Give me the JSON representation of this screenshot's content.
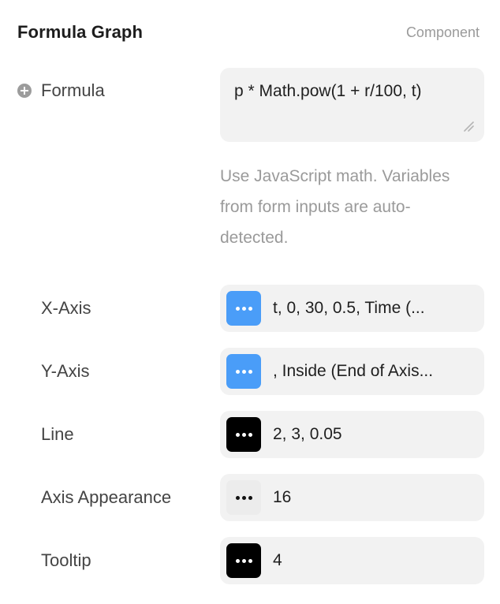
{
  "header": {
    "title": "Formula Graph",
    "badge": "Component"
  },
  "formula": {
    "label": "Formula",
    "value": "p * Math.pow(1 + r/100, t)",
    "hint": "Use JavaScript math. Variables from form inputs are auto-detected."
  },
  "properties": [
    {
      "label": "X-Axis",
      "value": "t, 0, 30, 0.5, Time (...",
      "swatch": "blue",
      "swatch_color": "#4a9df8"
    },
    {
      "label": "Y-Axis",
      "value": ", Inside (End of Axis...",
      "swatch": "blue",
      "swatch_color": "#4a9df8"
    },
    {
      "label": "Line",
      "value": "2, 3, 0.05",
      "swatch": "black",
      "swatch_color": "#000000"
    },
    {
      "label": "Axis Appearance",
      "value": "16",
      "swatch": "light",
      "swatch_color": "#ececec"
    },
    {
      "label": "Tooltip",
      "value": "4",
      "swatch": "black",
      "swatch_color": "#000000"
    }
  ],
  "icons": {
    "add": "plus-circle-icon",
    "resize": "resize-handle-icon",
    "more": "more-horizontal-icon"
  }
}
